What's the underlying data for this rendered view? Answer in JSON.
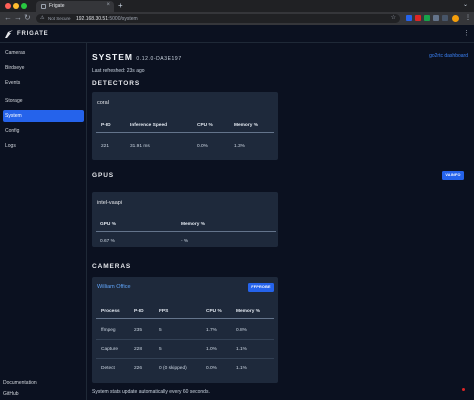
{
  "browser": {
    "tab_title": "Frigate",
    "security_label": "Not Secure",
    "url_host": "192.168.30.51",
    "url_path": ":5000/system",
    "traffic_colors": [
      "#ff5f57",
      "#febc2e",
      "#28c840"
    ],
    "icons": {
      "back": "arrow-left-icon",
      "forward": "arrow-right-icon",
      "reload": "reload-icon",
      "star": "star-icon"
    }
  },
  "app": {
    "title": "FRIGATE",
    "logo_icon": "frigate-logo-icon"
  },
  "sidebar": {
    "items": [
      {
        "label": "Cameras"
      },
      {
        "label": "Birdseye"
      },
      {
        "label": "Events"
      },
      {
        "label": "Storage"
      },
      {
        "label": "System",
        "active": true
      },
      {
        "label": "Config"
      },
      {
        "label": "Logs"
      }
    ],
    "footer": [
      {
        "label": "Documentation"
      },
      {
        "label": "GitHub"
      }
    ]
  },
  "page": {
    "title": "SYSTEM",
    "version": "0.12.0-DA3E197",
    "go2rtc_link": "go2rtc dashboard",
    "last_refreshed": "Last refreshed: 23s ago",
    "footer_note": "System stats update automatically every 60 seconds."
  },
  "detectors": {
    "heading": "DETECTORS",
    "card": {
      "name": "coral",
      "columns": [
        "P-ID",
        "Inference Speed",
        "CPU %",
        "Memory %"
      ],
      "rows": [
        [
          "221",
          "31.91 ms",
          "0.0%",
          "1.3%"
        ]
      ]
    }
  },
  "gpus": {
    "heading": "GPUS",
    "button": "VAINFO",
    "card": {
      "name": "intel-vaapi",
      "columns": [
        "GPU %",
        "Memory %"
      ],
      "rows": [
        [
          "0.67 %",
          "- %"
        ]
      ]
    }
  },
  "cameras": {
    "heading": "CAMERAS",
    "card": {
      "name": "William Office",
      "button": "FFPROBE",
      "columns": [
        "Process",
        "P-ID",
        "FPS",
        "CPU %",
        "Memory %"
      ],
      "rows": [
        [
          "ffmpeg",
          "235",
          "5",
          "1.7%",
          "0.8%"
        ],
        [
          "Capture",
          "228",
          "5",
          "1.0%",
          "1.1%"
        ],
        [
          "Detect",
          "226",
          "0 (0 skipped)",
          "0.0%",
          "1.1%"
        ]
      ]
    }
  },
  "colors": {
    "accent": "#2563eb",
    "link": "#3b82f6",
    "card_bg": "#1e293b",
    "page_bg": "#0b1120"
  }
}
